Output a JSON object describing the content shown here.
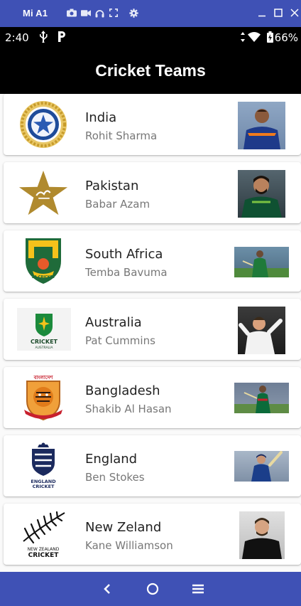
{
  "emulator": {
    "device_name": "Mi A1"
  },
  "status_bar": {
    "time": "2:40",
    "battery": "66%"
  },
  "app_bar": {
    "title": "Cricket Teams"
  },
  "teams": [
    {
      "name": "India",
      "captain": "Rohit Sharma",
      "jersey": "#1e3a8a"
    },
    {
      "name": "Pakistan",
      "captain": "Babar Azam",
      "jersey": "#0f5132"
    },
    {
      "name": "South Africa",
      "captain": "Temba Bavuma",
      "jersey": "#1f7a3a"
    },
    {
      "name": "Australia",
      "captain": "Pat Cummins",
      "jersey": "#f2f2f2"
    },
    {
      "name": "Bangladesh",
      "captain": "Shakib Al Hasan",
      "jersey": "#0b6b3a"
    },
    {
      "name": "England",
      "captain": "Ben Stokes",
      "jersey": "#1b3e8a"
    },
    {
      "name": "New Zeland",
      "captain": "Kane Williamson",
      "jersey": "#111111"
    }
  ],
  "logo_text": {
    "sa": "SA CRICKET",
    "aus_line1": "CRICKET",
    "aus_line2": "AUSTRALIA",
    "ban": "বাংলাদেশ",
    "eng_line1": "ENGLAND",
    "eng_line2": "CRICKET",
    "nz_line1": "NEW ZEALAND",
    "nz_line2": "CRICKET"
  },
  "icons": {
    "camera": "camera-icon",
    "video": "video-icon",
    "headset": "headset-icon",
    "fullscreen": "fullscreen-icon",
    "settings": "gear-icon",
    "minimize": "minimize-icon",
    "maximize": "maximize-icon",
    "close": "close-icon",
    "back": "back-icon",
    "home": "home-icon",
    "menu": "menu-icon"
  },
  "colors": {
    "emulator_blue": "#3f51b5",
    "app_bar": "#000000",
    "background": "#fafafa"
  }
}
